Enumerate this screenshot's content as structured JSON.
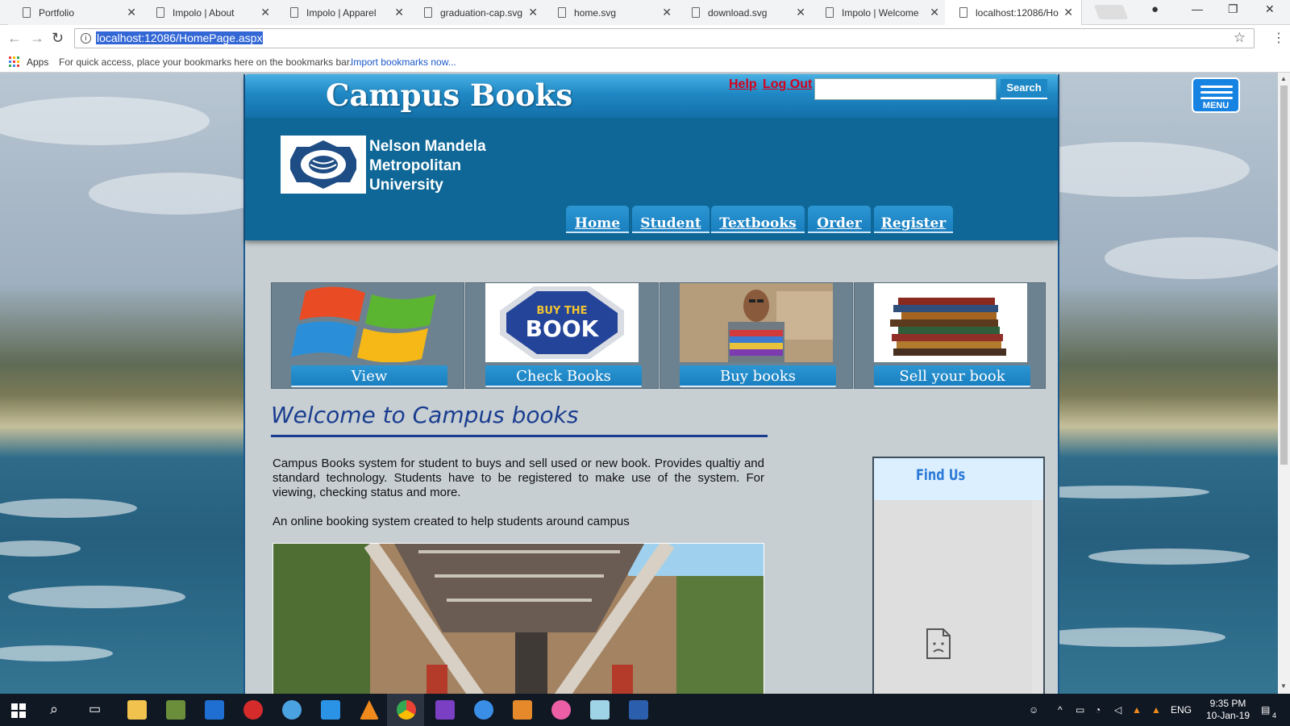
{
  "browser": {
    "tabs": [
      {
        "label": "Portfolio"
      },
      {
        "label": "Impolo | About"
      },
      {
        "label": "Impolo | Apparel"
      },
      {
        "label": "graduation-cap.svg"
      },
      {
        "label": "home.svg"
      },
      {
        "label": "download.svg"
      },
      {
        "label": "Impolo | Welcome"
      },
      {
        "label": "localhost:12086/Ho"
      }
    ],
    "url": "localhost:12086/HomePage.aspx",
    "bookmarks": {
      "apps_label": "Apps",
      "hint": "For quick access, place your bookmarks here on the bookmarks bar.",
      "import_link": "Import bookmarks now..."
    }
  },
  "site": {
    "title": "Campus Books",
    "help_link": "Help",
    "logout_link": "Log Out",
    "search_placeholder": "",
    "search_button": "Search",
    "university": {
      "line1": "Nelson Mandela",
      "line2": "Metropolitan",
      "line3": "University"
    },
    "nav": [
      "Home",
      "Student",
      "Textbooks",
      "Order",
      "Register"
    ],
    "tiles": [
      {
        "label": "View",
        "icon": "windows-logo"
      },
      {
        "label": "Check Books",
        "icon": "buy-the-book-badge"
      },
      {
        "label": "Buy books",
        "icon": "student-with-books-photo"
      },
      {
        "label": "Sell your book",
        "icon": "book-stack-photo"
      }
    ],
    "tile_badge_text": "BUY THE BOOK",
    "welcome_heading": "Welcome to Campus books",
    "intro_text": "Campus Books system for student to buys and sell used or new book. Provides qualtiy and standard technology. Students have to be registered to make use of the system. For viewing, checking status and more.",
    "intro_text_2": "An online booking system created to help students around campus",
    "find_us": "Find Us",
    "menu_label": "MENU"
  },
  "taskbar": {
    "language": "ENG",
    "time": "9:35 PM",
    "date": "10-Jan-19",
    "notifications": "4"
  },
  "colors": {
    "header_blue": "#0e6796",
    "accent_blue": "#1a7fbf",
    "link_red": "#d6001c",
    "heading_navy": "#1a3d8f"
  }
}
